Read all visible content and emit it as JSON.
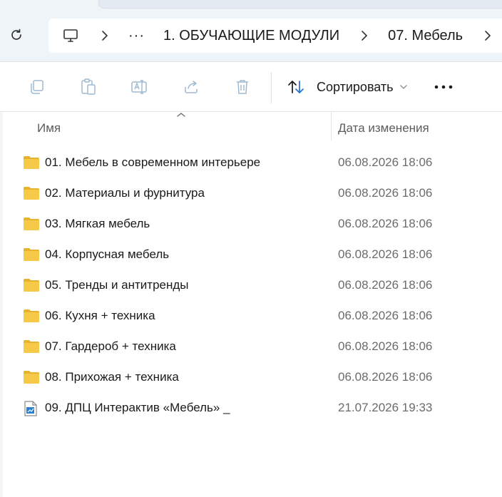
{
  "address": {
    "dots": "···",
    "crumbs": [
      "1. ОБУЧАЮЩИЕ МОДУЛИ",
      "07. Мебель"
    ]
  },
  "toolbar": {
    "sort_label": "Сортировать",
    "icons": [
      "copy-icon",
      "paste-icon",
      "rename-icon",
      "share-icon",
      "delete-icon",
      "sort-icon",
      "chevron-down-icon",
      "more-icon"
    ]
  },
  "columns": {
    "name": "Имя",
    "date": "Дата изменения"
  },
  "files": [
    {
      "name": "01. Мебель в современном интерьере",
      "date": "06.08.2026 18:06",
      "type": "folder"
    },
    {
      "name": "02. Материалы и фурнитура",
      "date": "06.08.2026 18:06",
      "type": "folder"
    },
    {
      "name": "03. Мягкая мебель",
      "date": "06.08.2026 18:06",
      "type": "folder"
    },
    {
      "name": "04. Корпусная мебель",
      "date": "06.08.2026 18:06",
      "type": "folder"
    },
    {
      "name": "05. Тренды и антитренды",
      "date": "06.08.2026 18:06",
      "type": "folder"
    },
    {
      "name": "06. Кухня + техника",
      "date": "06.08.2026 18:06",
      "type": "folder"
    },
    {
      "name": "07. Гардероб + техника",
      "date": "06.08.2026 18:06",
      "type": "folder"
    },
    {
      "name": "08. Прихожая + техника",
      "date": "06.08.2026 18:06",
      "type": "folder"
    },
    {
      "name": "09. ДПЦ Интерактив «Мебель» _",
      "date": "21.07.2026 19:33",
      "type": "shortcut"
    }
  ],
  "colors": {
    "folder": "#f7c948",
    "folder_dark": "#e8b32c",
    "topbar_bg": "#eff4f9",
    "icon_disabled": "#9fb9cf"
  }
}
